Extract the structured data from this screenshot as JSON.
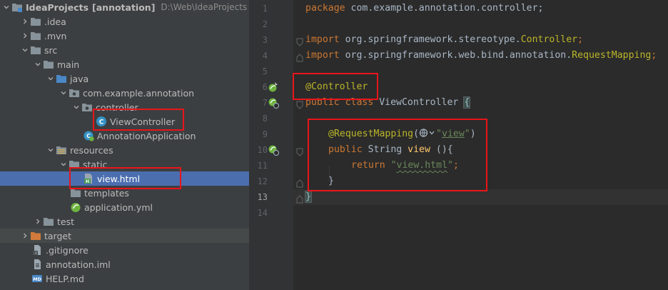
{
  "tree": {
    "root": {
      "label": "IdeaProjects",
      "suffix": "[annotation]",
      "path": "D:\\Web\\IdeaProjects"
    },
    "items": [
      {
        "label": "IdeaProjects"
      },
      {
        "label": ".idea"
      },
      {
        "label": ".mvn"
      },
      {
        "label": "src"
      },
      {
        "label": "main"
      },
      {
        "label": "java"
      },
      {
        "label": "com.example.annotation"
      },
      {
        "label": "controller"
      },
      {
        "label": "ViewController"
      },
      {
        "label": "AnnotationApplication"
      },
      {
        "label": "resources"
      },
      {
        "label": "static"
      },
      {
        "label": "view.html"
      },
      {
        "label": "templates"
      },
      {
        "label": "application.yml"
      },
      {
        "label": "test"
      },
      {
        "label": "target"
      },
      {
        "label": ".gitignore"
      },
      {
        "label": "annotation.iml"
      },
      {
        "label": "HELP.md"
      }
    ]
  },
  "editor": {
    "line_numbers": [
      "1",
      "2",
      "3",
      "4",
      "5",
      "6",
      "7",
      "8",
      "9",
      "10",
      "11",
      "12",
      "13",
      "14"
    ],
    "code": {
      "l1_kw": "package",
      "l1_rest": " com.example.annotation.controller;",
      "l3_kw": "import",
      "l3_pkg": " org.springframework.stereotype.",
      "l3_cls": "Controller",
      "l3_end": ";",
      "l4_kw": "import",
      "l4_pkg": " org.springframework.web.bind.annotation.",
      "l4_cls": "RequestMapping",
      "l4_end": ";",
      "l6_ann": "@Controller",
      "l7_kw": "public class",
      "l7_name": " ViewController ",
      "l7_brace": "{",
      "l9_ann": "@RequestMapping",
      "l9_open": "(",
      "l9_q1": "\"",
      "l9_val": "view",
      "l9_q2": "\"",
      "l9_close": ")",
      "l10_kw": "public",
      "l10_type": " String ",
      "l10_name": "view",
      "l10_rest": " (){",
      "l11_kw": "return",
      "l11_sp": " ",
      "l11_q1": "\"",
      "l11_str": "view.html",
      "l11_q2": "\"",
      "l11_end": ";",
      "l12_brace": "}",
      "l13_brace": "}"
    }
  },
  "colors": {
    "keyword": "#cc7832",
    "annotation": "#bbb529",
    "string": "#6a8759",
    "method": "#ffc66d",
    "highlight_box": "#e8151b",
    "selection": "#4b6eaf"
  }
}
